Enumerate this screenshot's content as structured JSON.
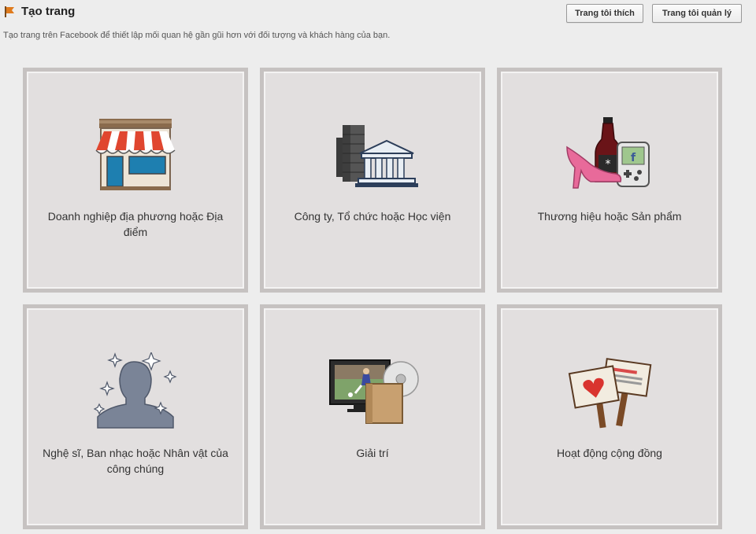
{
  "header": {
    "title": "Tạo trang",
    "subtitle": "Tạo trang trên Facebook để thiết lập mối quan hệ gần gũi hơn với đối tượng và khách hàng của bạn.",
    "buttons": {
      "liked": "Trang tôi thích",
      "managed": "Trang tôi quản lý"
    }
  },
  "categories": [
    {
      "label": "Doanh nghiệp địa phương hoặc Địa điểm",
      "icon": "storefront-icon"
    },
    {
      "label": "Công ty, Tổ chức hoặc Học viện",
      "icon": "buildings-icon"
    },
    {
      "label": "Thương hiệu hoặc Sản phẩm",
      "icon": "products-icon"
    },
    {
      "label": "Nghệ sĩ, Ban nhạc hoặc Nhân vật của công chúng",
      "icon": "public-figure-icon"
    },
    {
      "label": "Giải trí",
      "icon": "entertainment-icon"
    },
    {
      "label": "Hoạt động cộng đồng",
      "icon": "community-signs-icon"
    }
  ],
  "colors": {
    "background": "#ededed",
    "tile": "#e2dfdf",
    "tile_border": "#c6c2c1",
    "accent_flag": "#e07b1d"
  }
}
